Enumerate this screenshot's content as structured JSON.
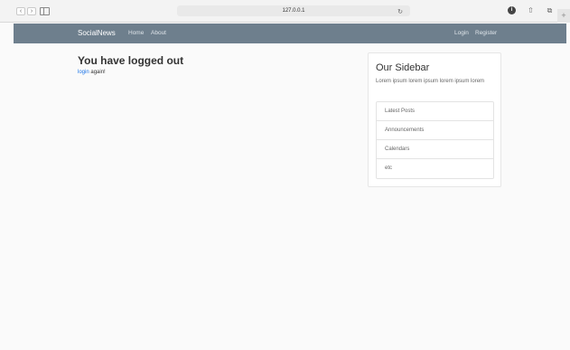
{
  "browser": {
    "url": "127.0.0.1",
    "back_icon": "chevron-left-icon",
    "forward_icon": "chevron-right-icon"
  },
  "navbar": {
    "brand": "SocialNews",
    "links": [
      "Home",
      "About"
    ],
    "auth_links": [
      "Login",
      "Register"
    ]
  },
  "main": {
    "title": "You have logged out",
    "login_link": "login",
    "message_rest": " again!"
  },
  "sidebar": {
    "title": "Our Sidebar",
    "text": "Lorem ipsum lorem ipsum lorem ipsum lorem",
    "items": [
      "Latest Posts",
      "Announcements",
      "Calendars",
      "etc"
    ]
  },
  "colors": {
    "navbar": "#6e7f8d",
    "link": "#1a73e8",
    "background": "#fafafa"
  }
}
